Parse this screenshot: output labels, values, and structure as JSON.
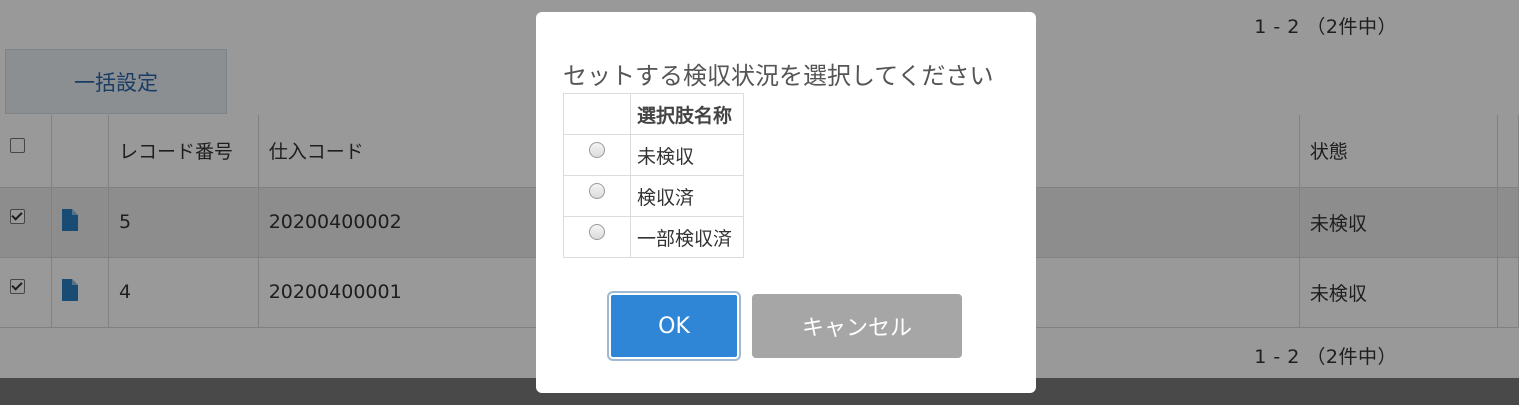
{
  "pager": {
    "top": "1 - 2 （2件中）",
    "bottom": "1 - 2 （2件中）"
  },
  "toolbar": {
    "bulk_set_label": "一括設定"
  },
  "table": {
    "headers": {
      "record_no": "レコード番号",
      "purchase_code": "仕入コード",
      "status": "状態"
    },
    "rows": [
      {
        "checked": true,
        "record_no": "5",
        "purchase_code": "20200400002",
        "status": "未検収"
      },
      {
        "checked": true,
        "record_no": "4",
        "purchase_code": "20200400001",
        "status": "未検収"
      }
    ]
  },
  "dialog": {
    "title": "セットする検収状況を選択してください",
    "choices_header": "選択肢名称",
    "choices": [
      "未検収",
      "検収済",
      "一部検収済"
    ],
    "ok_label": "OK",
    "cancel_label": "キャンセル"
  },
  "icons": {
    "record": "document-icon"
  },
  "colors": {
    "primary": "#2f86d7",
    "secondary": "#a6a6a6",
    "link": "#2a66a8",
    "icon": "#2a7fc4"
  }
}
